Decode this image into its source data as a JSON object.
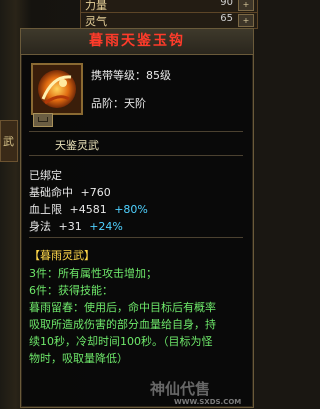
{
  "background": {
    "left_label": "武",
    "rows": [
      {
        "label": "力量",
        "value": "90"
      },
      {
        "label": "灵气",
        "value": "65"
      }
    ]
  },
  "tooltip": {
    "title": "暮雨天鉴玉钩",
    "carry_level": "携带等级：85级",
    "grade": "品阶：天阶",
    "type_line": "天鉴灵武",
    "bound": "已绑定",
    "stats": [
      {
        "name": "基础命中",
        "base": "+760",
        "bonus": ""
      },
      {
        "name": "血上限",
        "base": "+4581",
        "bonus": "+80%"
      },
      {
        "name": "身法",
        "base": "+31",
        "bonus": "+24%"
      }
    ],
    "set_name": "【暮雨灵武】",
    "set_3": "3件：所有属性攻击增加；",
    "set_6": "6件：获得技能：",
    "skill_desc": [
      "暮雨留春：使用后，命中目标后有概率",
      "吸取所造成伤害的部分血量给自身，持",
      "续10秒，冷却时间100秒。（目标为怪",
      "物时，吸取量降低）"
    ]
  },
  "watermark": {
    "text": "神仙代售",
    "url": "WWW.SXDS.COM"
  },
  "colors": {
    "title": "#ff3b2a",
    "stat_bonus": "#4fd1ff",
    "set": "#ffd84a",
    "skill": "#6ee86a"
  }
}
